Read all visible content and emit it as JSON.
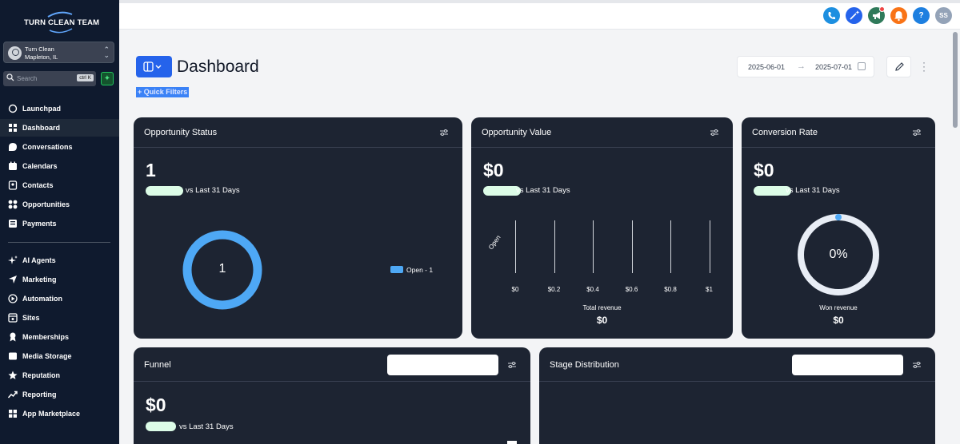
{
  "brand": {
    "name": "TURN CLEAN TEAM"
  },
  "account": {
    "name": "Turn Clean",
    "location": "Mapleton, IL"
  },
  "search": {
    "placeholder": "Search",
    "shortcut": "ctrl K"
  },
  "nav": [
    {
      "label": "Launchpad",
      "icon": "launchpad-icon"
    },
    {
      "label": "Dashboard",
      "icon": "dashboard-icon",
      "active": true
    },
    {
      "label": "Conversations",
      "icon": "chat-icon"
    },
    {
      "label": "Calendars",
      "icon": "calendar-icon"
    },
    {
      "label": "Contacts",
      "icon": "contacts-icon"
    },
    {
      "label": "Opportunities",
      "icon": "opportunities-icon"
    },
    {
      "label": "Payments",
      "icon": "payments-icon"
    },
    {
      "label": "AI Agents",
      "icon": "ai-agents-icon"
    },
    {
      "label": "Marketing",
      "icon": "marketing-icon"
    },
    {
      "label": "Automation",
      "icon": "automation-icon"
    },
    {
      "label": "Sites",
      "icon": "sites-icon"
    },
    {
      "label": "Memberships",
      "icon": "memberships-icon"
    },
    {
      "label": "Media Storage",
      "icon": "media-storage-icon"
    },
    {
      "label": "Reputation",
      "icon": "star-icon"
    },
    {
      "label": "Reporting",
      "icon": "reporting-icon"
    },
    {
      "label": "App Marketplace",
      "icon": "app-marketplace-icon"
    }
  ],
  "topbar": {
    "user_initials": "SS",
    "help": "?",
    "colors": {
      "phone": "#1d8fe0",
      "magic": "#2563eb",
      "megaphone": "#2f7a5a",
      "bell": "#f97316",
      "help": "#1d7fe0",
      "avatar": "#94a3b8"
    }
  },
  "header": {
    "title": "Dashboard",
    "quick_filters": "+  Quick Filters",
    "date_start": "2025-06-01",
    "date_end": "2025-07-01"
  },
  "cards": {
    "opportunity_status": {
      "title": "Opportunity Status",
      "value": "1",
      "comparison": "vs Last 31 Days",
      "donut_label": "1",
      "legend": "Open - 1"
    },
    "opportunity_value": {
      "title": "Opportunity Value",
      "value": "$0",
      "comparison": "vs Last 31 Days",
      "y_category": "Open",
      "x_ticks": [
        "$0",
        "$0.2",
        "$0.4",
        "$0.6",
        "$0.8",
        "$1"
      ],
      "footer_label": "Total revenue",
      "footer_value": "$0"
    },
    "conversion_rate": {
      "title": "Conversion Rate",
      "value": "$0",
      "comparison": "vs Last 31 Days",
      "gauge_label": "0%",
      "footer_label": "Won revenue",
      "footer_value": "$0"
    },
    "funnel": {
      "title": "Funnel",
      "value": "$0",
      "comparison": "vs Last 31 Days"
    },
    "stage_distribution": {
      "title": "Stage Distribution"
    }
  }
}
